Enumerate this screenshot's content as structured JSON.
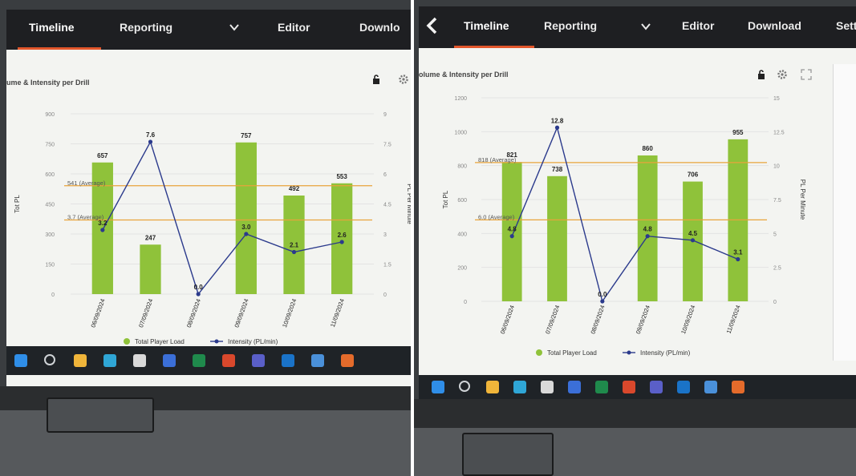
{
  "photos": [
    {
      "nav": {
        "tabs": [
          {
            "label": "Timeline",
            "active": true
          },
          {
            "label": "Reporting",
            "active": false
          },
          {
            "label": "Editor",
            "active": false
          },
          {
            "label": "Downlo",
            "active": false
          }
        ]
      },
      "card_title": "ume & Intensity per Drill",
      "icons": [
        "lock-icon",
        "settings-gear-icon"
      ],
      "taskbar_icons": [
        "windows-start-icon",
        "search-icon",
        "file-explorer-icon",
        "edge-browser-icon",
        "app-icon",
        "store-icon",
        "excel-icon",
        "powerpoint-icon",
        "teams-icon",
        "outlook-icon",
        "chrome-icon",
        "office-icon"
      ]
    },
    {
      "nav": {
        "tabs": [
          {
            "label": "Timeline",
            "active": true
          },
          {
            "label": "Reporting",
            "active": false
          },
          {
            "label": "Editor",
            "active": false
          },
          {
            "label": "Download",
            "active": false
          },
          {
            "label": "Sett",
            "active": false
          }
        ]
      },
      "card_title": "olume & Intensity per Drill",
      "icons": [
        "lock-icon",
        "settings-gear-icon",
        "expand-icon"
      ],
      "taskbar_icons": [
        "windows-start-icon",
        "search-icon",
        "file-explorer-icon",
        "edge-browser-icon",
        "app-icon",
        "store-icon",
        "excel-icon",
        "powerpoint-icon",
        "teams-icon",
        "outlook-icon",
        "chrome-icon",
        "office-icon"
      ]
    }
  ],
  "chart_data": [
    {
      "type": "bar",
      "categories": [
        "06/09/2024",
        "07/09/2024",
        "08/09/2024",
        "09/09/2024",
        "10/09/2024",
        "11/09/2024"
      ],
      "series": [
        {
          "name": "Total Player Load",
          "type": "bar",
          "values": [
            657,
            247,
            null,
            757,
            492,
            553
          ],
          "labels": [
            "657",
            "247",
            "",
            "757",
            "492",
            "553"
          ],
          "color": "#8fc23a"
        },
        {
          "name": "Intensity (PL/min)",
          "type": "line",
          "values": [
            3.2,
            7.6,
            0.0,
            3.0,
            2.1,
            2.6
          ],
          "labels": [
            "3.2",
            "7.6",
            "0.0",
            "3.0",
            "2.1",
            "2.6"
          ],
          "color": "#2b3a8c"
        }
      ],
      "averages": [
        {
          "label": "541 (Average)",
          "value": 541,
          "axis": "left"
        },
        {
          "label": "3.7 (Average)",
          "value": 3.7,
          "axis": "right"
        }
      ],
      "ylabel": "Tot PL",
      "y2label": "PL Per Minute",
      "ylim": [
        0,
        900
      ],
      "y2lim": [
        0,
        9
      ],
      "yticks": [
        "0",
        "150",
        "300",
        "450",
        "600",
        "750",
        "900"
      ],
      "y2ticks": [
        "0",
        "1.5",
        "3",
        "4.5",
        "6",
        "7.5",
        "9"
      ],
      "legend_position": "bottom"
    },
    {
      "type": "bar",
      "categories": [
        "06/09/2024",
        "07/09/2024",
        "08/09/2024",
        "09/09/2024",
        "10/09/2024",
        "11/09/2024"
      ],
      "series": [
        {
          "name": "Total Player Load",
          "type": "bar",
          "values": [
            821,
            738,
            null,
            860,
            706,
            955
          ],
          "labels": [
            "821",
            "738",
            "",
            "860",
            "706",
            "955"
          ],
          "color": "#8fc23a"
        },
        {
          "name": "Intensity (PL/min)",
          "type": "line",
          "values": [
            4.8,
            12.8,
            0.0,
            4.8,
            4.5,
            3.1
          ],
          "labels": [
            "4.8",
            "12.8",
            "0.0",
            "4.8",
            "4.5",
            "3.1"
          ],
          "color": "#2b3a8c"
        }
      ],
      "averages": [
        {
          "label": "818 (Average)",
          "value": 818,
          "axis": "left"
        },
        {
          "label": "6.0 (Average)",
          "value": 6.0,
          "axis": "right"
        }
      ],
      "ylabel": "Tot PL",
      "y2label": "PL Per Minute",
      "ylim": [
        0,
        1200
      ],
      "y2lim": [
        0,
        15
      ],
      "yticks": [
        "0",
        "200",
        "400",
        "600",
        "800",
        "1000",
        "1200"
      ],
      "y2ticks": [
        "0",
        "2.5",
        "5",
        "7.5",
        "10",
        "12.5",
        "15"
      ],
      "legend_position": "bottom"
    }
  ]
}
